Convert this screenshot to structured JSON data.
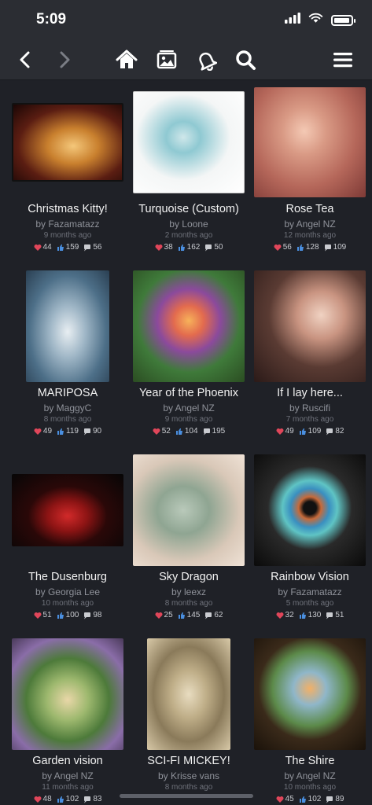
{
  "status": {
    "time": "5:09"
  },
  "colors": {
    "heart": "#e0465a",
    "like": "#4a8fe0",
    "comment": "#c9cbd0",
    "background": "#1f2127",
    "bar": "#2b2d33"
  },
  "nav": {
    "icons": [
      "back-arrow-icon",
      "forward-arrow-icon",
      "home-icon",
      "gallery-icon",
      "bell-icon",
      "search-icon",
      "hamburger-menu-icon"
    ]
  },
  "gallery": {
    "items": [
      {
        "title": "Christmas Kitty!",
        "author": "by Fazamatazz",
        "time": "9 months ago",
        "hearts": "44",
        "likes": "159",
        "comments": "56"
      },
      {
        "title": "Turquoise (Custom)",
        "author": "by Loone",
        "time": "2 months ago",
        "hearts": "38",
        "likes": "162",
        "comments": "50"
      },
      {
        "title": "Rose Tea",
        "author": "by Angel NZ",
        "time": "12 months ago",
        "hearts": "56",
        "likes": "128",
        "comments": "109"
      },
      {
        "title": "MARIPOSA",
        "author": "by MaggyC",
        "time": "8 months ago",
        "hearts": "49",
        "likes": "119",
        "comments": "90"
      },
      {
        "title": "Year of the Phoenix",
        "author": "by Angel NZ",
        "time": "9 months ago",
        "hearts": "52",
        "likes": "104",
        "comments": "195"
      },
      {
        "title": "If I lay here...",
        "author": "by Ruscifi",
        "time": "7 months ago",
        "hearts": "49",
        "likes": "109",
        "comments": "82"
      },
      {
        "title": "The Dusenburg",
        "author": "by Georgia Lee",
        "time": "10 months ago",
        "hearts": "51",
        "likes": "100",
        "comments": "98"
      },
      {
        "title": "Sky Dragon",
        "author": "by leexz",
        "time": "8 months ago",
        "hearts": "25",
        "likes": "145",
        "comments": "62"
      },
      {
        "title": "Rainbow Vision",
        "author": "by Fazamatazz",
        "time": "5 months ago",
        "hearts": "32",
        "likes": "130",
        "comments": "51"
      },
      {
        "title": "Garden vision",
        "author": "by Angel NZ",
        "time": "11 months ago",
        "hearts": "48",
        "likes": "102",
        "comments": "83"
      },
      {
        "title": "SCI-FI MICKEY!",
        "author": "by Krisse vans",
        "time": "8 months ago",
        "hearts": "",
        "likes": "",
        "comments": ""
      },
      {
        "title": "The Shire",
        "author": "by Angel NZ",
        "time": "10 months ago",
        "hearts": "45",
        "likes": "102",
        "comments": "89"
      }
    ]
  }
}
